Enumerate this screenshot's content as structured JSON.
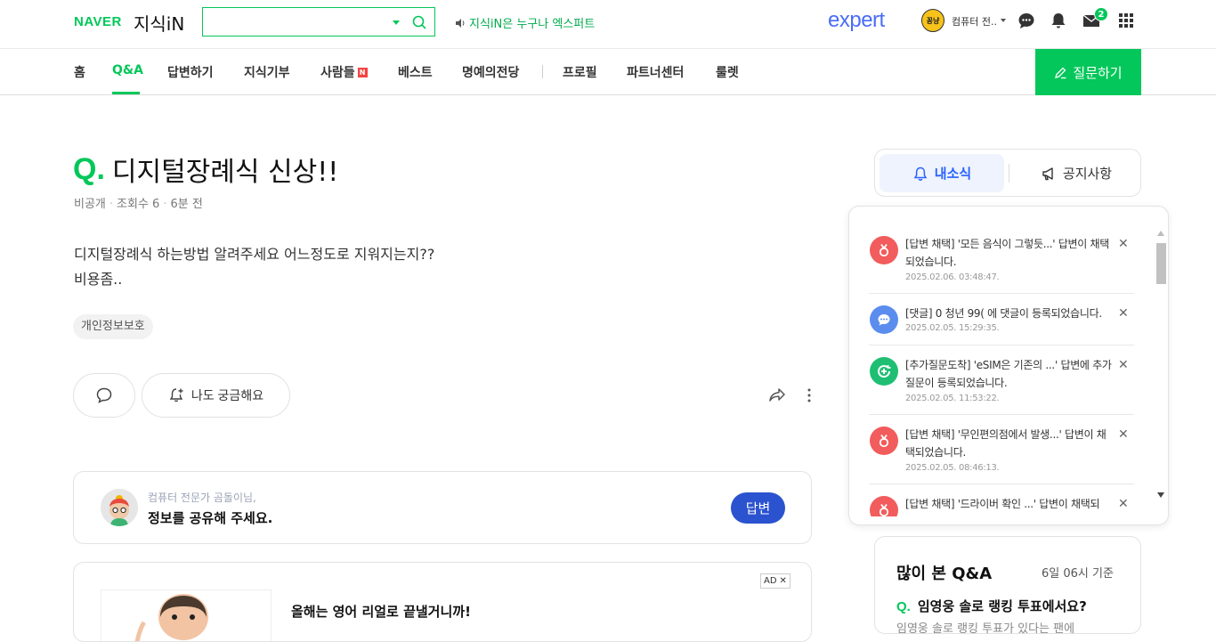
{
  "header": {
    "naver_logo": "NAVER",
    "kin_logo": "지식iN",
    "search": {
      "value": "",
      "placeholder": ""
    },
    "promo_text": "지식iN은 누구나 엑스퍼트",
    "expert_logo": "expert",
    "user_avatar_text": "꽁냥",
    "user_name": "컴퓨터 전..",
    "mail_count": "2"
  },
  "gnb": {
    "items": [
      "홈",
      "Q&A",
      "답변하기",
      "지식기부",
      "사람들",
      "베스트",
      "명예의전당",
      "프로필",
      "파트너센터",
      "룰렛"
    ],
    "new_badge": "N",
    "ask_button": "질문하기"
  },
  "question": {
    "mark": "Q.",
    "title": "디지털장례식 신상!!",
    "author": "비공개",
    "views": "조회수 6",
    "time": "6분 전",
    "body_line1": "디지털장례식 하는방법 알려주세요 어느정도로 지워지는지??",
    "body_line2": "비용좀..",
    "tag": "개인정보보호",
    "curious_button": "나도 궁금해요"
  },
  "answer_prompt": {
    "sub": "컴퓨터 전문가 곰돌이님,",
    "main": "정보를 공유해 주세요.",
    "button": "답변"
  },
  "ad": {
    "label": "AD",
    "close": "✕",
    "text": "올해는 영어 리얼로 끝낼거니까!"
  },
  "sidebar": {
    "tab_news": "내소식",
    "tab_notice": "공지사항",
    "notifications": [
      {
        "type": "adopt",
        "icon_color": "#f25c5c",
        "message": "[답변 채택] '모든 음식이 그렇듯...' 답변이 채택되었습니다.",
        "date": "2025.02.06. 03:48:47."
      },
      {
        "type": "comment",
        "icon_color": "#5b8def",
        "message": "[댓글] 0 청년 99( 에 댓글이 등록되었습니다.",
        "date": "2025.02.05. 15:29:35."
      },
      {
        "type": "followup",
        "icon_color": "#1fbf73",
        "message": "[추가질문도착] 'eSIM은 기존의 ...' 답변에 추가질문이 등록되었습니다.",
        "date": "2025.02.05. 11:53:22."
      },
      {
        "type": "adopt",
        "icon_color": "#f25c5c",
        "message": "[답변 채택] '무인편의점에서 발생...' 답변이 채택되었습니다.",
        "date": "2025.02.05. 08:46:13."
      },
      {
        "type": "adopt",
        "icon_color": "#f25c5c",
        "message": "[답변 채택] '드라이버 확인 ...' 답변이 채택되",
        "date": ""
      }
    ],
    "close_glyph": "✕",
    "popular": {
      "title": "많이 본 Q&A",
      "time": "6일 06시 기준",
      "mark": "Q.",
      "item": "임영웅 솔로 랭킹 투표에서요?",
      "sub": "임영웅 솔로 랭킹 투표가 있다는 팬에"
    }
  },
  "colors": {
    "brand_green": "#03c75a",
    "answer_blue": "#2b52cf",
    "expert_blue": "#4a6cf7",
    "news_blue": "#2962ff"
  }
}
